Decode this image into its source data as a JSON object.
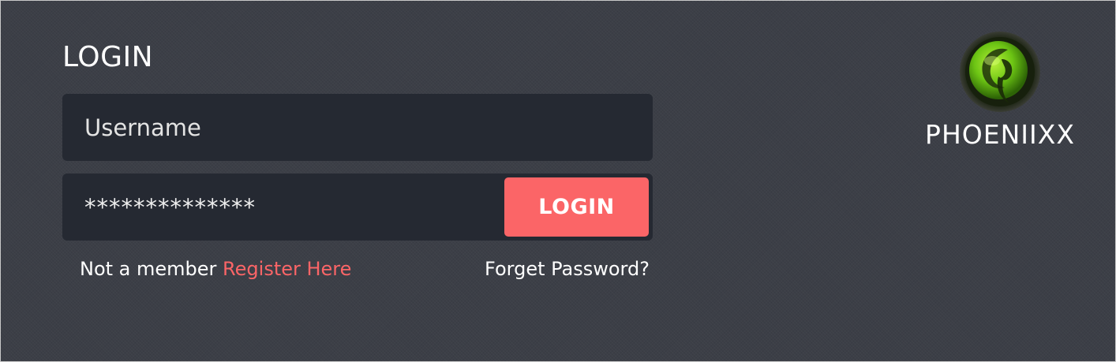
{
  "login_form": {
    "title": "LOGIN",
    "username": {
      "value": "",
      "placeholder": "Username"
    },
    "password": {
      "value": "**************",
      "placeholder": ""
    },
    "submit_label": "LOGIN",
    "register_prompt": "Not a member",
    "register_link": "Register Here",
    "forgot_link": "Forget Password?"
  },
  "brand": {
    "name": "PHOENIIXX",
    "logo_icon": "phoenix-swirl-logo"
  },
  "colors": {
    "background": "#3c3f47",
    "field": "#252932",
    "accent": "#fb6567",
    "text": "#ffffff",
    "logo_green": "#7ad31c"
  }
}
